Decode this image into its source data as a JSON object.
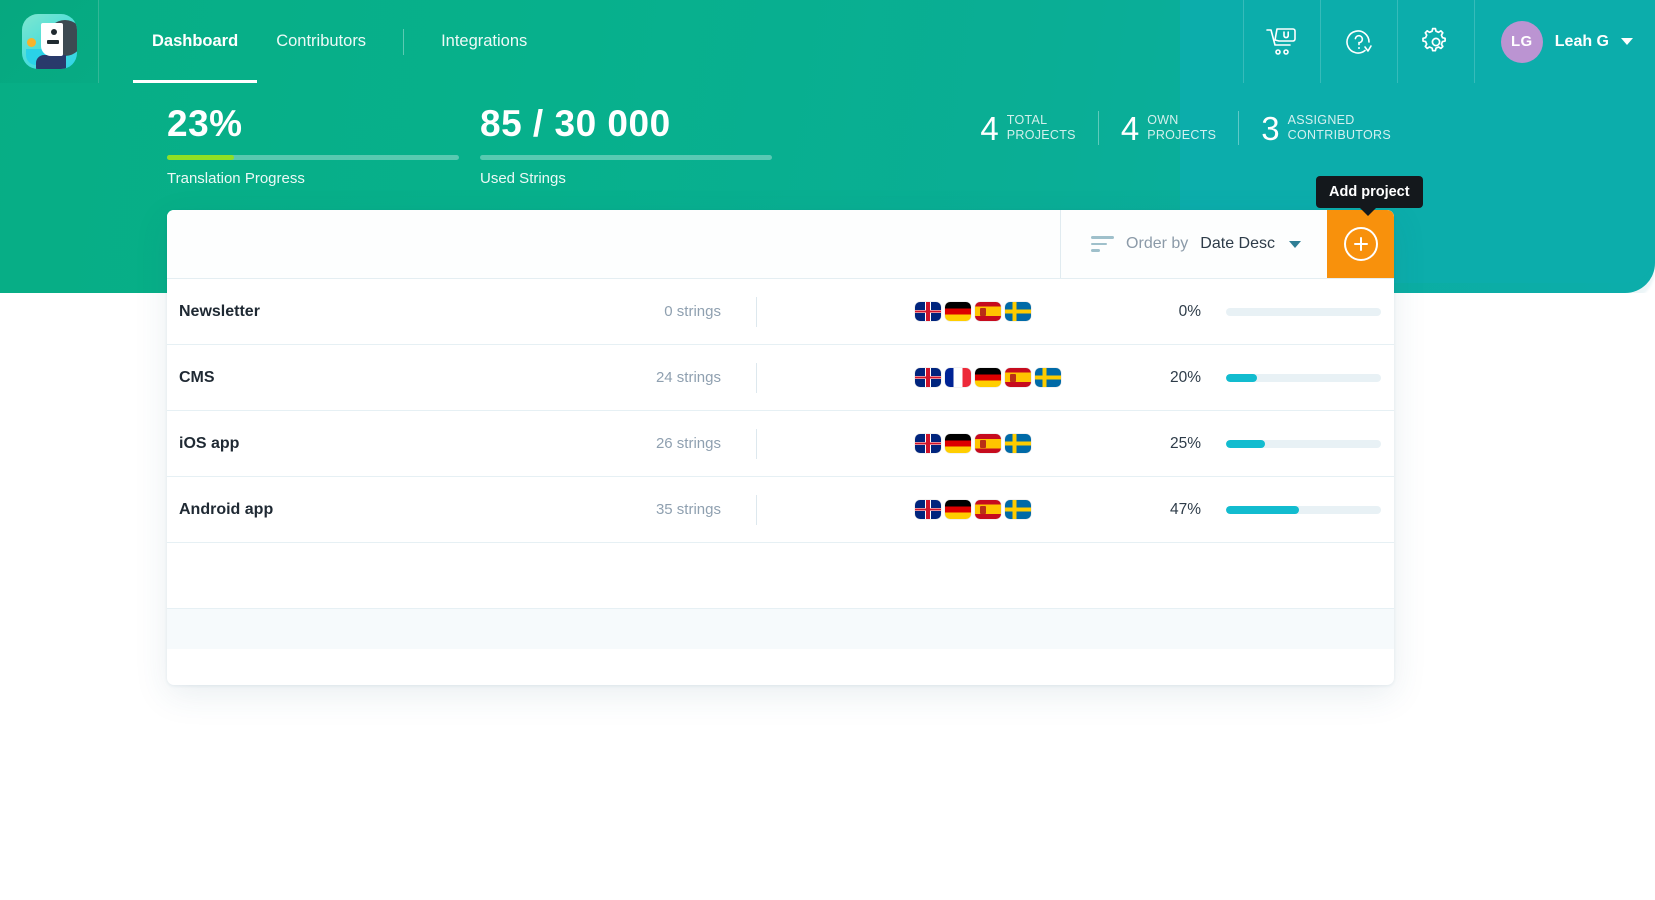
{
  "brand": {
    "logo_name": "lokalise-logo",
    "accent_green": "#07ae85",
    "accent_teal": "#0cadab",
    "accent_orange": "#f8910c",
    "progress_green": "#8fe025",
    "progress_cyan": "#12bccf"
  },
  "nav": {
    "items": [
      {
        "label": "Dashboard",
        "active": true
      },
      {
        "label": "Contributors",
        "active": false
      },
      {
        "label": "Integrations",
        "active": false
      }
    ]
  },
  "topbar": {
    "cart_icon": "shopping-cart-icon",
    "help_icon": "help-question-icon",
    "settings_icon": "gear-icon",
    "user": {
      "initials": "LG",
      "name": "Leah G",
      "caret": "chevron-down-icon"
    }
  },
  "stats": {
    "translation": {
      "value": "23%",
      "label": "Translation Progress",
      "percent": 23
    },
    "strings": {
      "value": "85 / 30 000",
      "label": "Used Strings",
      "percent": 0
    },
    "counts": [
      {
        "number": "4",
        "line1": "TOTAL",
        "line2": "PROJECTS"
      },
      {
        "number": "4",
        "line1": "OWN",
        "line2": "PROJECTS"
      },
      {
        "number": "3",
        "line1": "ASSIGNED",
        "line2": "CONTRIBUTORS"
      }
    ]
  },
  "toolbar": {
    "sort_icon": "sort-lines-icon",
    "order_label": "Order by",
    "order_value": "Date Desc",
    "order_caret": "chevron-down-icon",
    "add_icon": "plus-circle-icon",
    "add_tooltip": "Add project"
  },
  "projects": [
    {
      "name": "Newsletter",
      "strings": "0 strings",
      "languages": [
        "gb",
        "de",
        "es",
        "se"
      ],
      "percent_label": "0%",
      "percent": 0
    },
    {
      "name": "CMS",
      "strings": "24 strings",
      "languages": [
        "gb",
        "fr",
        "de",
        "es",
        "se"
      ],
      "percent_label": "20%",
      "percent": 20
    },
    {
      "name": "iOS app",
      "strings": "26 strings",
      "languages": [
        "gb",
        "de",
        "es",
        "se"
      ],
      "percent_label": "25%",
      "percent": 25
    },
    {
      "name": "Android app",
      "strings": "35 strings",
      "languages": [
        "gb",
        "de",
        "es",
        "se"
      ],
      "percent_label": "47%",
      "percent": 47
    }
  ]
}
